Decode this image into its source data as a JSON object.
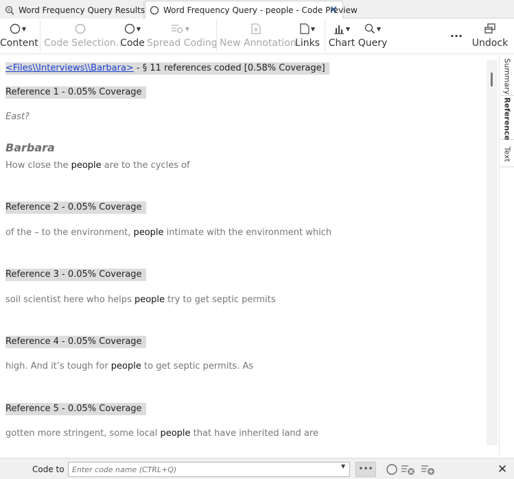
{
  "tabs": [
    {
      "label": "Word Frequency Query Results",
      "active": false
    },
    {
      "label": "Word Frequency Query - people - Code Preview",
      "active": true
    }
  ],
  "ribbon": {
    "content": "Content",
    "code_selection": "Code Selection...",
    "code": "Code",
    "spread_coding": "Spread Coding",
    "new_annotation": "New Annotation",
    "links": "Links",
    "chart": "Chart",
    "query": "Query",
    "more": "...",
    "undock": "Undock"
  },
  "header": {
    "file_link": "<Files\\\\Interviews\\\\Barbara>",
    "summary": " - § 11 references coded  [0.58% Coverage]"
  },
  "keyword": "people",
  "references": [
    {
      "label": "Reference 1 - 0.05% Coverage",
      "pre_question": "East?",
      "speaker": "Barbara",
      "before": "How close the ",
      "after": " are to the cycles of"
    },
    {
      "label": "Reference 2 - 0.05% Coverage",
      "before": "of the – to the environment, ",
      "after": " intimate with the environment which"
    },
    {
      "label": "Reference 3 - 0.05% Coverage",
      "before": "soil scientist here who helps ",
      "after": " try to get septic permits"
    },
    {
      "label": "Reference 4 - 0.05% Coverage",
      "before": "high. And it’s tough for ",
      "after": " to get septic permits. As"
    },
    {
      "label": "Reference 5 - 0.05% Coverage",
      "before": "gotten more stringent, some local ",
      "after": " that have inherited land are"
    }
  ],
  "side_tabs": [
    "Summary",
    "Reference",
    "Text"
  ],
  "code_bar": {
    "label": "Code to",
    "placeholder": "Enter code name (CTRL+Q)",
    "more": "•••"
  },
  "colors": {
    "highlight": "#dcdcdc",
    "link": "#1a3fd0",
    "accent": "#1a4b8c"
  }
}
